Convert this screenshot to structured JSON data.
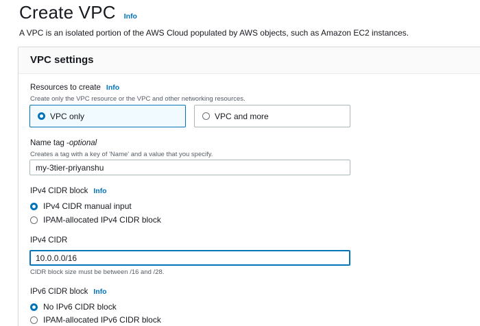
{
  "header": {
    "title": "Create VPC",
    "info": "Info"
  },
  "description": "A VPC is an isolated portion of the AWS Cloud populated by AWS objects, such as Amazon EC2 instances.",
  "panel": {
    "title": "VPC settings"
  },
  "resources": {
    "label": "Resources to create",
    "info": "Info",
    "hint": "Create only the VPC resource or the VPC and other networking resources.",
    "options": [
      {
        "label": "VPC only",
        "selected": true
      },
      {
        "label": "VPC and more",
        "selected": false
      }
    ]
  },
  "name_tag": {
    "label": "Name tag - ",
    "optional": "optional",
    "hint": "Creates a tag with a key of 'Name' and a value that you specify.",
    "value": "my-3tier-priyanshu"
  },
  "ipv4_block": {
    "label": "IPv4 CIDR block",
    "info": "Info",
    "options": [
      {
        "label": "IPv4 CIDR manual input",
        "selected": true
      },
      {
        "label": "IPAM-allocated IPv4 CIDR block",
        "selected": false
      }
    ]
  },
  "ipv4_cidr": {
    "label": "IPv4 CIDR",
    "value": "10.0.0.0/16",
    "hint": "CIDR block size must be between /16 and /28."
  },
  "ipv6_block": {
    "label": "IPv6 CIDR block",
    "info": "Info",
    "options": [
      {
        "label": "No IPv6 CIDR block",
        "selected": true
      },
      {
        "label": "IPAM-allocated IPv6 CIDR block",
        "selected": false
      }
    ]
  },
  "colors": {
    "accent": "#0073bb",
    "tile_selected_bg": "#f1faff",
    "text": "#16191f",
    "hint": "#545b64"
  }
}
